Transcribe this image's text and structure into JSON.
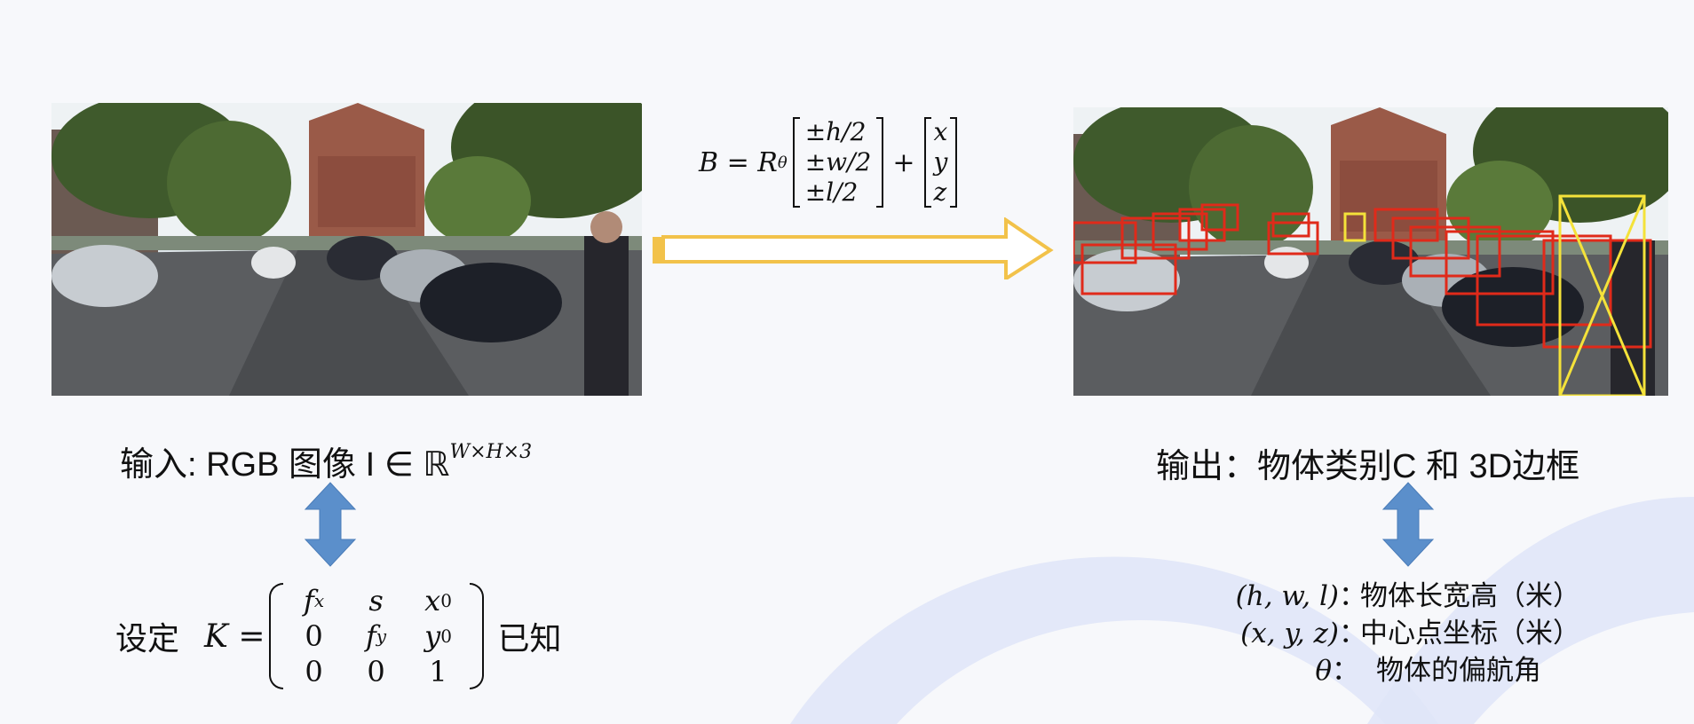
{
  "colors": {
    "arrow_fill": "#ffffff",
    "arrow_stroke": "#f2c24a",
    "double_arrow": "#5b8fcb",
    "box_car": "#e02a1a",
    "box_person": "#f4e23a",
    "arc_color": "#dfe5f8"
  },
  "input_label": {
    "prefix": "输入: RGB 图像 I ∈ ℝ",
    "superscript": "W×H×3"
  },
  "output_label": "输出：物体类别C 和 3D边框",
  "box_formula": {
    "lhs": "B = R",
    "subscript": "θ",
    "rows": [
      "±h/2",
      "±w/2",
      "±l/2"
    ],
    "plus": "+",
    "vec": [
      "x",
      "y",
      "z"
    ]
  },
  "intrinsics": {
    "prefix": "设定",
    "lhs": "K =",
    "matrix": [
      [
        "f",
        "s",
        "x"
      ],
      [
        "0",
        "f",
        "y"
      ],
      [
        "0",
        "0",
        "1"
      ]
    ],
    "subs": [
      [
        "x",
        "",
        "0"
      ],
      [
        "",
        "y",
        "0"
      ],
      [
        "",
        "",
        ""
      ]
    ],
    "suffix": "已知"
  },
  "params": [
    {
      "key": "(h, w, l)",
      "value": "物体长宽高（米）"
    },
    {
      "key": "(x, y, z)",
      "value": "中心点坐标（米）"
    },
    {
      "key": "θ",
      "value": "物体的偏航角"
    }
  ],
  "icons": {
    "process_arrow": "right-arrow-icon",
    "link_arrows": "up-down-arrow-icon"
  }
}
